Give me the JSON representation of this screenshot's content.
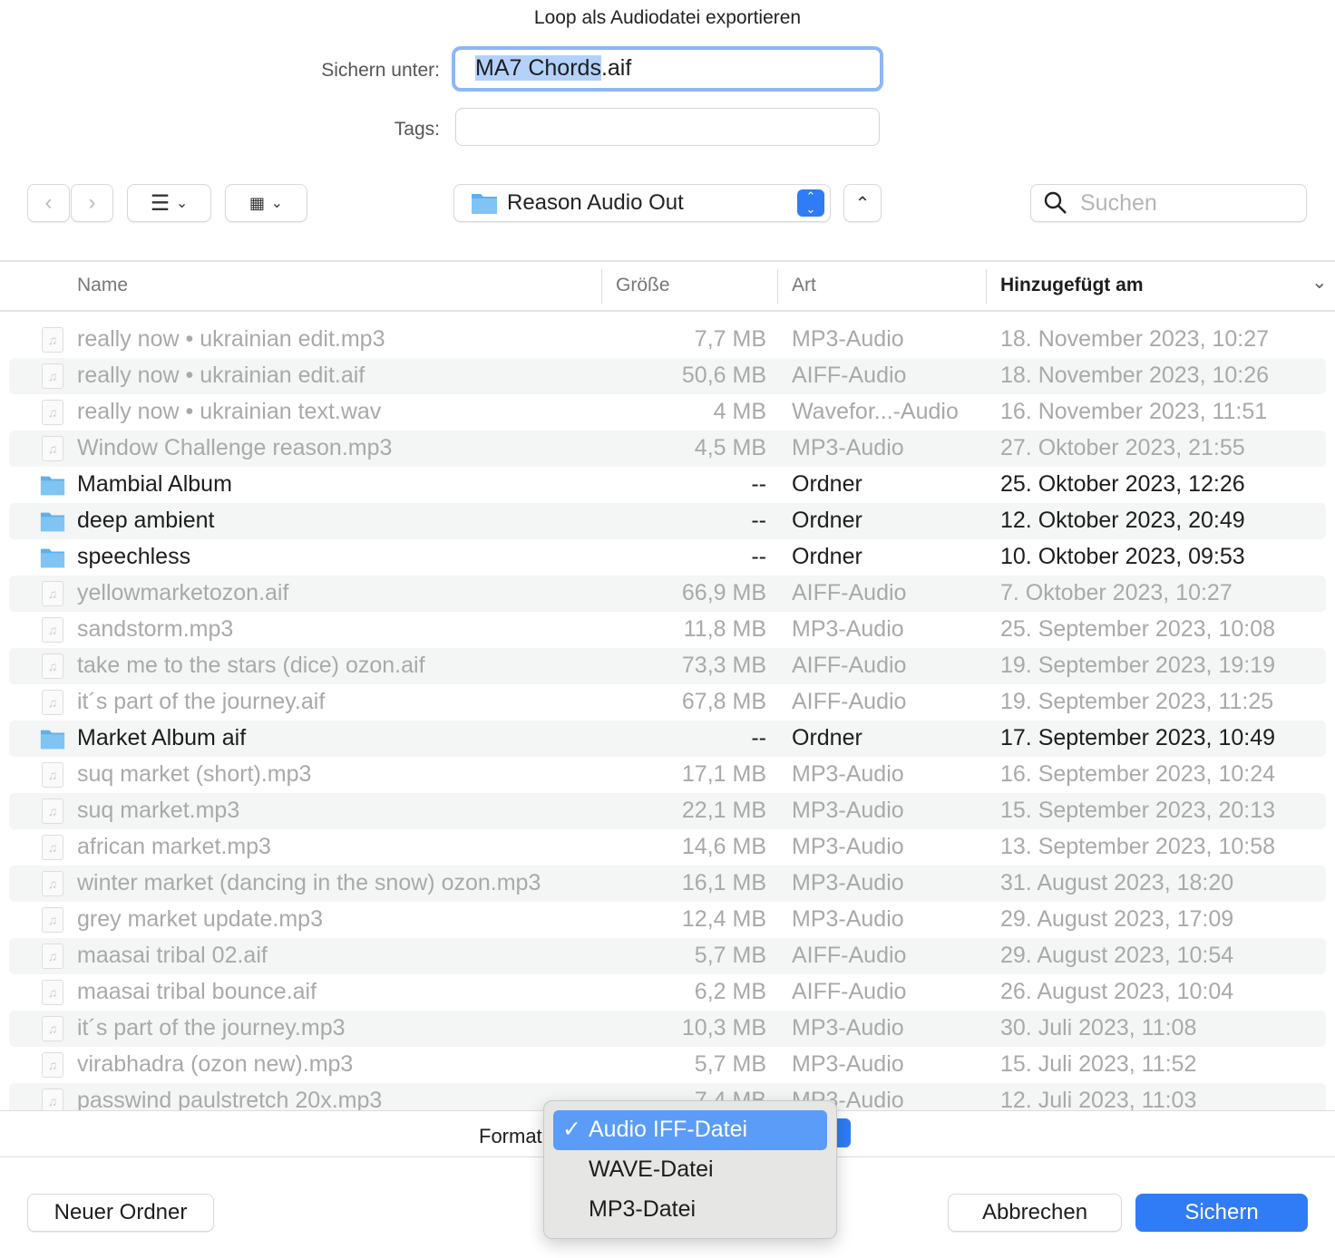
{
  "dialog": {
    "title": "Loop als Audiodatei exportieren",
    "save_as_label": "Sichern unter:",
    "save_as_selected": "MA7 Chords",
    "save_as_ext": ".aif",
    "tags_label": "Tags:",
    "tags_value": ""
  },
  "toolbar": {
    "location": "Reason Audio Out",
    "search_placeholder": "Suchen"
  },
  "columns": {
    "name": "Name",
    "size": "Größe",
    "kind": "Art",
    "date": "Hinzugefügt am"
  },
  "rows": [
    {
      "name": "really now • ukrainian edit.mp3",
      "size": "7,7 MB",
      "kind": "MP3-Audio",
      "date": "18. November 2023, 10:27",
      "folder": false
    },
    {
      "name": "really now • ukrainian edit.aif",
      "size": "50,6 MB",
      "kind": "AIFF-Audio",
      "date": "18. November 2023, 10:26",
      "folder": false
    },
    {
      "name": "really now • ukrainian text.wav",
      "size": "4 MB",
      "kind": "Wavefor...-Audio",
      "date": "16. November 2023, 11:51",
      "folder": false
    },
    {
      "name": "Window Challenge reason.mp3",
      "size": "4,5 MB",
      "kind": "MP3-Audio",
      "date": "27. Oktober 2023, 21:55",
      "folder": false
    },
    {
      "name": "Mambial Album",
      "size": "--",
      "kind": "Ordner",
      "date": "25. Oktober 2023, 12:26",
      "folder": true
    },
    {
      "name": "deep ambient",
      "size": "--",
      "kind": "Ordner",
      "date": "12. Oktober 2023, 20:49",
      "folder": true
    },
    {
      "name": "speechless",
      "size": "--",
      "kind": "Ordner",
      "date": "10. Oktober 2023, 09:53",
      "folder": true
    },
    {
      "name": "yellowmarketozon.aif",
      "size": "66,9 MB",
      "kind": "AIFF-Audio",
      "date": "7. Oktober 2023, 10:27",
      "folder": false
    },
    {
      "name": "sandstorm.mp3",
      "size": "11,8 MB",
      "kind": "MP3-Audio",
      "date": "25. September 2023, 10:08",
      "folder": false
    },
    {
      "name": "take me to the stars (dice) ozon.aif",
      "size": "73,3 MB",
      "kind": "AIFF-Audio",
      "date": "19. September 2023, 19:19",
      "folder": false
    },
    {
      "name": "it´s part of the journey.aif",
      "size": "67,8 MB",
      "kind": "AIFF-Audio",
      "date": "19. September 2023, 11:25",
      "folder": false
    },
    {
      "name": "Market Album aif",
      "size": "--",
      "kind": "Ordner",
      "date": "17. September 2023, 10:49",
      "folder": true
    },
    {
      "name": "suq market (short).mp3",
      "size": "17,1 MB",
      "kind": "MP3-Audio",
      "date": "16. September 2023, 10:24",
      "folder": false
    },
    {
      "name": "suq market.mp3",
      "size": "22,1 MB",
      "kind": "MP3-Audio",
      "date": "15. September 2023, 20:13",
      "folder": false
    },
    {
      "name": "african market.mp3",
      "size": "14,6 MB",
      "kind": "MP3-Audio",
      "date": "13. September 2023, 10:58",
      "folder": false
    },
    {
      "name": "winter market (dancing in the snow) ozon.mp3",
      "size": "16,1 MB",
      "kind": "MP3-Audio",
      "date": "31. August 2023, 18:20",
      "folder": false
    },
    {
      "name": "grey market update.mp3",
      "size": "12,4 MB",
      "kind": "MP3-Audio",
      "date": "29. August 2023, 17:09",
      "folder": false
    },
    {
      "name": "maasai tribal 02.aif",
      "size": "5,7 MB",
      "kind": "AIFF-Audio",
      "date": "29. August 2023, 10:54",
      "folder": false
    },
    {
      "name": "maasai tribal bounce.aif",
      "size": "6,2 MB",
      "kind": "AIFF-Audio",
      "date": "26. August 2023, 10:04",
      "folder": false
    },
    {
      "name": "it´s part of the journey.mp3",
      "size": "10,3 MB",
      "kind": "MP3-Audio",
      "date": "30. Juli 2023, 11:08",
      "folder": false
    },
    {
      "name": "virabhadra (ozon new).mp3",
      "size": "5,7 MB",
      "kind": "MP3-Audio",
      "date": "15. Juli 2023, 11:52",
      "folder": false
    },
    {
      "name": "passwind paulstretch 20x.mp3",
      "size": "7,4 MB",
      "kind": "MP3-Audio",
      "date": "12. Juli 2023, 11:03",
      "folder": false
    }
  ],
  "format": {
    "label": "Format:",
    "options": [
      "Audio IFF-Datei",
      "WAVE-Datei",
      "MP3-Datei"
    ],
    "selected": "Audio IFF-Datei",
    "check": "✓"
  },
  "buttons": {
    "new_folder": "Neuer Ordner",
    "cancel": "Abbrechen",
    "save": "Sichern"
  },
  "colors": {
    "accent": "#2f7cf6",
    "selection": "#5b9cf8"
  }
}
